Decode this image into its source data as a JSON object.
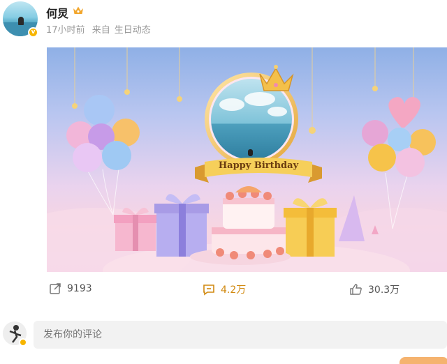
{
  "post": {
    "username": "何炅",
    "time": "17小时前",
    "source_prefix": "来自",
    "source": "生日动态",
    "badge_icon": "crown-icon"
  },
  "card": {
    "banner_text": "Happy Birthday"
  },
  "actions": {
    "repost_count": "9193",
    "comment_count": "4.2万",
    "like_count": "30.3万"
  },
  "comment": {
    "placeholder": "发布你的评论"
  },
  "colors": {
    "verified": "#f7b500",
    "comment_accent": "#d1890f"
  }
}
